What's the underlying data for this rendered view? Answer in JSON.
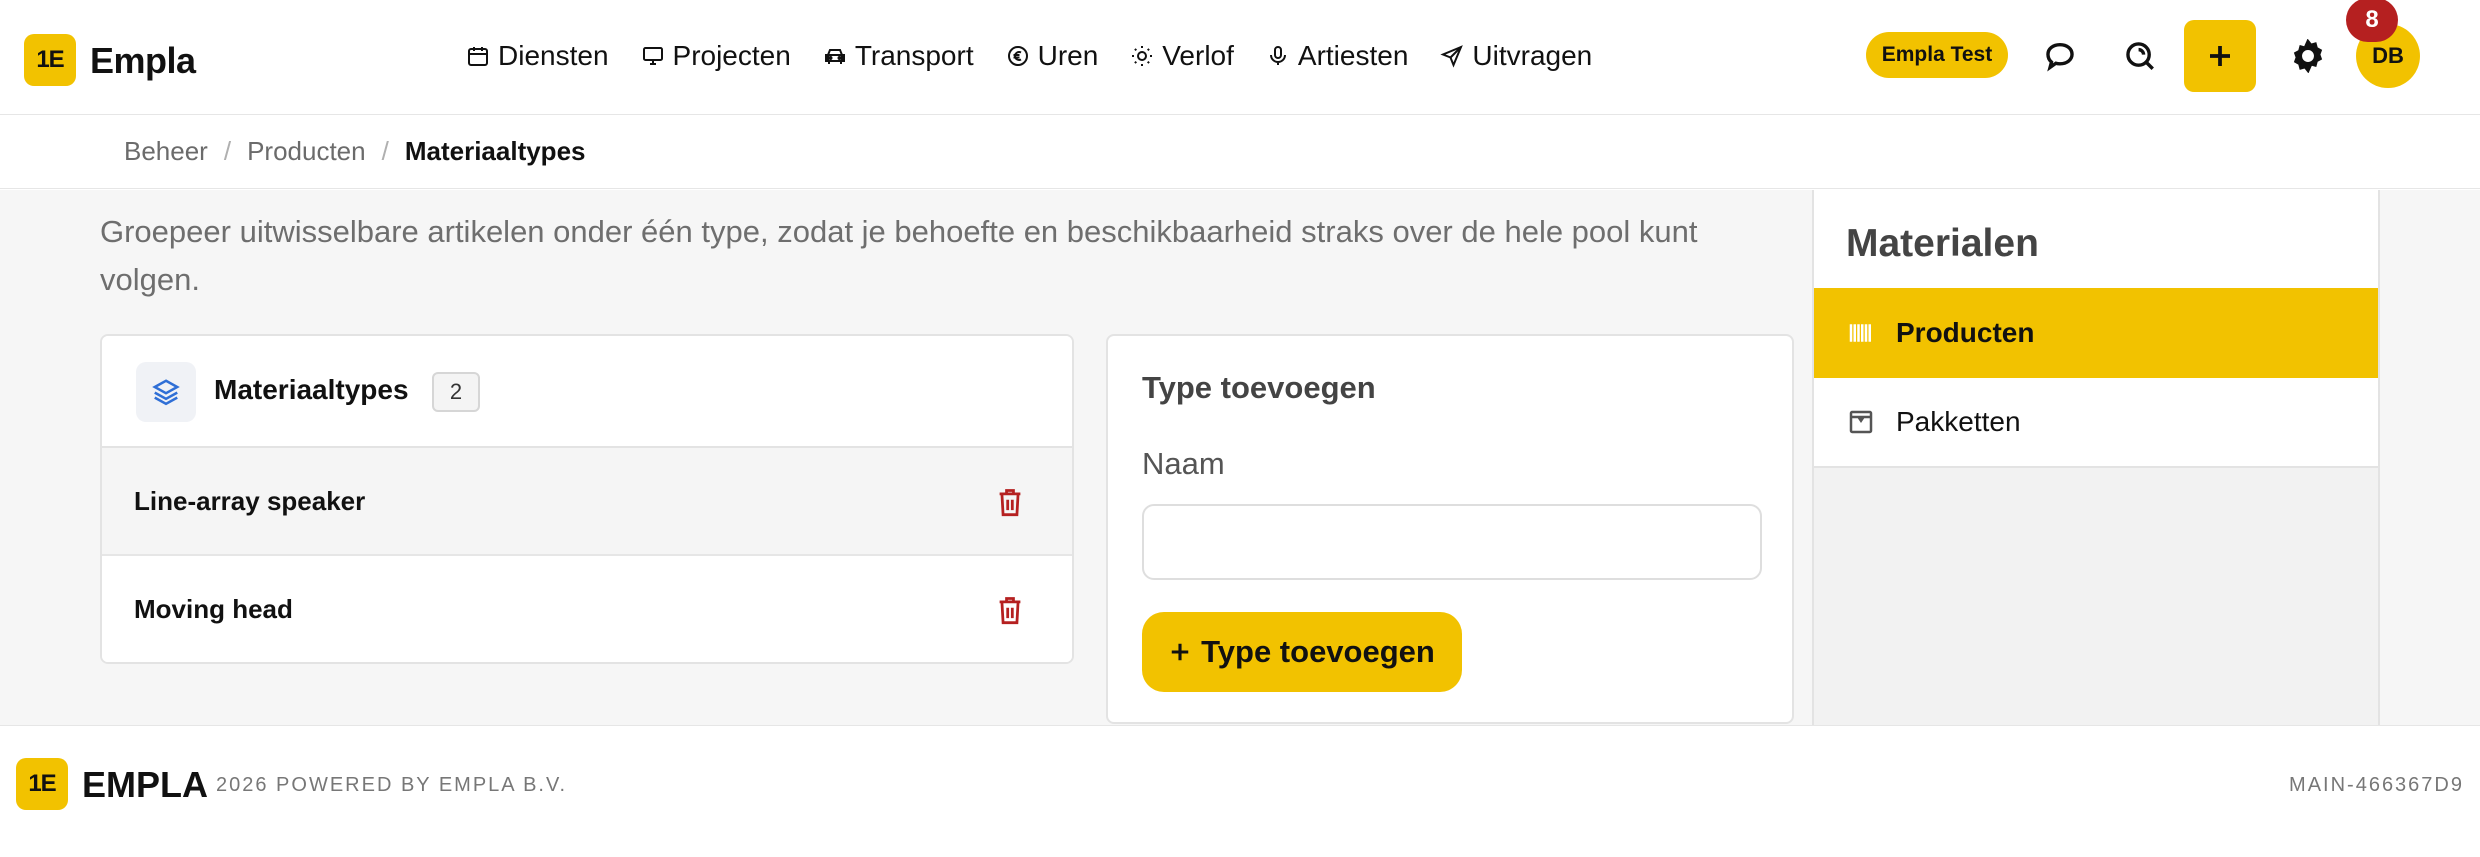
{
  "app": {
    "logo_mark": "1E",
    "name": "Empla"
  },
  "nav": [
    {
      "label": "Diensten",
      "icon": "calendar-icon"
    },
    {
      "label": "Projecten",
      "icon": "monitor-icon"
    },
    {
      "label": "Transport",
      "icon": "car-icon"
    },
    {
      "label": "Uren",
      "icon": "euro-icon"
    },
    {
      "label": "Verlof",
      "icon": "sun-icon"
    },
    {
      "label": "Artiesten",
      "icon": "microphone-icon"
    },
    {
      "label": "Uitvragen",
      "icon": "send-icon"
    }
  ],
  "header": {
    "tenant": "Empla Test",
    "notification_count": "8",
    "avatar_initials": "DB"
  },
  "breadcrumb": [
    "Beheer",
    "Producten",
    "Materiaaltypes"
  ],
  "intro": "Groepeer uitwisselbare artikelen onder één type, zodat je behoefte en beschikbaarheid straks over de hele pool kunt volgen.",
  "types_panel": {
    "title": "Materiaaltypes",
    "count": "2",
    "items": [
      {
        "name": "Line-array speaker"
      },
      {
        "name": "Moving head"
      }
    ]
  },
  "add_panel": {
    "title": "Type toevoegen",
    "field_label": "Naam",
    "field_value": "",
    "submit_label": "Type toevoegen"
  },
  "sidebar": {
    "title": "Materialen",
    "items": [
      {
        "label": "Producten",
        "icon": "barcode-icon",
        "active": true
      },
      {
        "label": "Pakketten",
        "icon": "package-icon",
        "active": false
      }
    ]
  },
  "footer": {
    "logo_mark": "1E",
    "brand": "EMPLA",
    "powered": "2026 POWERED BY EMPLA B.V.",
    "version": "MAIN-466367D9"
  },
  "colors": {
    "accent": "#f2c200",
    "danger": "#b52020",
    "link_icon": "#2f6fd6"
  }
}
